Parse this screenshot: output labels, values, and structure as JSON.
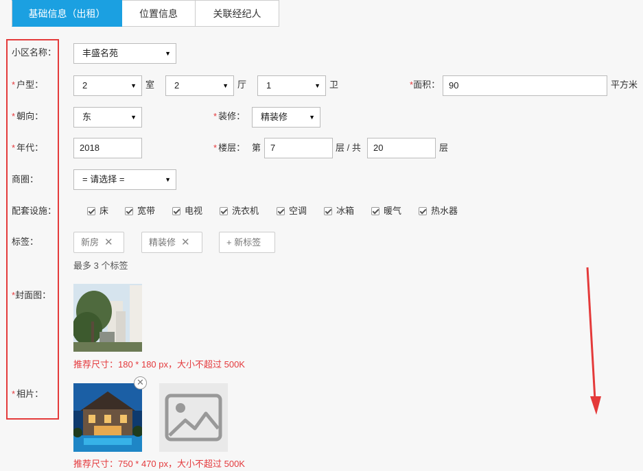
{
  "tabs": [
    {
      "label": "基础信息（出租）",
      "active": true
    },
    {
      "label": "位置信息",
      "active": false
    },
    {
      "label": "关联经纪人",
      "active": false
    }
  ],
  "form": {
    "community": {
      "label": "小区名称：",
      "value": "丰盛名苑"
    },
    "layout": {
      "label": "户型：",
      "room": {
        "value": "2",
        "unit": "室"
      },
      "hall": {
        "value": "2",
        "unit": "厅"
      },
      "bath": {
        "value": "1",
        "unit": "卫"
      }
    },
    "area": {
      "label": "面积：",
      "value": "90",
      "unit": "平方米"
    },
    "orientation": {
      "label": "朝向：",
      "value": "东"
    },
    "decoration": {
      "label": "装修：",
      "value": "精装修"
    },
    "year": {
      "label": "年代：",
      "value": "2018"
    },
    "floor": {
      "label": "楼层：",
      "prefix": "第",
      "value": "7",
      "middle": "层 / 共",
      "total": "20",
      "suffix": "层"
    },
    "business_area": {
      "label": "商圈：",
      "value": "= 请选择 ="
    },
    "facilities": {
      "label": "配套设施：",
      "items": [
        "床",
        "宽带",
        "电视",
        "洗衣机",
        "空调",
        "冰箱",
        "暖气",
        "热水器"
      ]
    },
    "tags": {
      "label": "标签：",
      "items": [
        "新房",
        "精装修"
      ],
      "add_label": "+ 新标签",
      "hint": "最多 3 个标签",
      "remove_glyph": "✕"
    },
    "cover": {
      "label": "封面图：",
      "hint": "推荐尺寸：180 * 180 px，大小不超过 500K"
    },
    "photos": {
      "label": "相片：",
      "hint": "推荐尺寸：750 * 470 px，大小不超过 500K",
      "remove_glyph": "✕"
    },
    "required_mark": "*"
  },
  "colors": {
    "accent": "#1ba0e1",
    "required": "#e4393c",
    "highlight": "#e43a3a"
  }
}
